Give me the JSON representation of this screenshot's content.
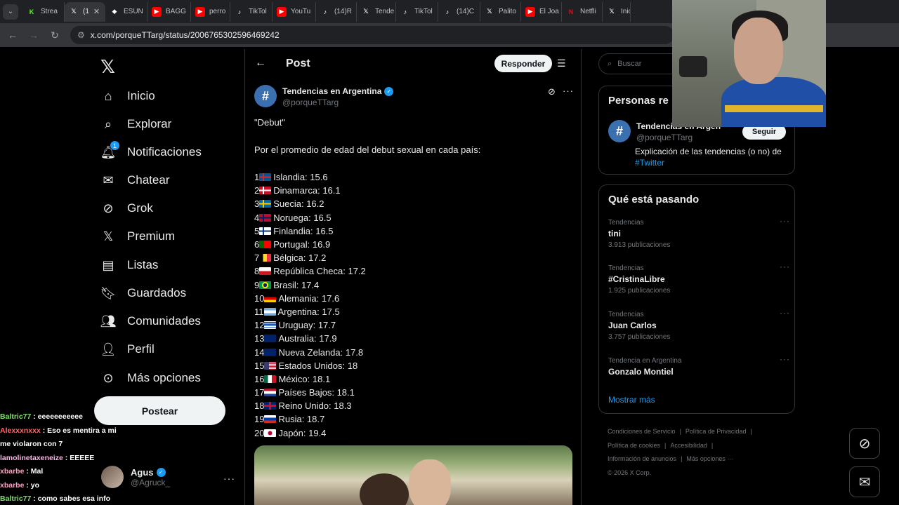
{
  "browser": {
    "tabs": [
      {
        "label": "Strea",
        "icon": "kick-icon",
        "color": "#53fc18"
      },
      {
        "label": "(1",
        "icon": "x-icon",
        "color": "#ffffff",
        "active": true
      },
      {
        "label": "ESUN",
        "icon": "esun-icon",
        "color": "#ffffff"
      },
      {
        "label": "BAGG",
        "icon": "youtube-icon",
        "color": "#ff0000"
      },
      {
        "label": "perro",
        "icon": "youtube-icon",
        "color": "#ff0000"
      },
      {
        "label": "TikTol",
        "icon": "tiktok-icon",
        "color": "#ffffff"
      },
      {
        "label": "YouTu",
        "icon": "youtube-icon",
        "color": "#ff0000"
      },
      {
        "label": "(14)R",
        "icon": "tiktok-icon",
        "color": "#ffffff"
      },
      {
        "label": "Tende",
        "icon": "x-icon",
        "color": "#ffffff"
      },
      {
        "label": "TikTol",
        "icon": "tiktok-icon",
        "color": "#ffffff"
      },
      {
        "label": "(14)C",
        "icon": "tiktok-icon",
        "color": "#ffffff"
      },
      {
        "label": "Palito",
        "icon": "x-icon",
        "color": "#ffffff"
      },
      {
        "label": "El Joa",
        "icon": "youtube-icon",
        "color": "#ff0000"
      },
      {
        "label": "Netfli",
        "icon": "netflix-icon",
        "color": "#e50914"
      },
      {
        "label": "Inic",
        "icon": "x-icon",
        "color": "#ffffff"
      }
    ],
    "url": "x.com/porqueTTarg/status/2006765302596469242"
  },
  "nav": {
    "items": [
      {
        "label": "Inicio",
        "icon": "home-icon"
      },
      {
        "label": "Explorar",
        "icon": "search-icon"
      },
      {
        "label": "Notificaciones",
        "icon": "bell-icon",
        "badge": "1"
      },
      {
        "label": "Chatear",
        "icon": "mail-icon"
      },
      {
        "label": "Grok",
        "icon": "grok-icon"
      },
      {
        "label": "Premium",
        "icon": "x-icon"
      },
      {
        "label": "Listas",
        "icon": "list-icon"
      },
      {
        "label": "Guardados",
        "icon": "bookmark-icon"
      },
      {
        "label": "Comunidades",
        "icon": "people-icon"
      },
      {
        "label": "Perfil",
        "icon": "person-icon"
      },
      {
        "label": "Más opciones",
        "icon": "more-circle-icon"
      }
    ],
    "post_button": "Postear",
    "account": {
      "name": "Agus",
      "handle": "@Agruck_"
    }
  },
  "chat": [
    {
      "user": "Baltric77",
      "text": " : eeeeeeeeeee"
    },
    {
      "user": "Alexxxnxxx",
      "text": " : Eso es mentira a mi"
    },
    {
      "user": "",
      "text": "me violaron con 7"
    },
    {
      "user": "lamolinetaxeneize",
      "text": " : EEEEE"
    },
    {
      "user": "xbarbe",
      "text": " : Mal"
    },
    {
      "user": "xbarbe",
      "text": " : yo"
    },
    {
      "user": "Baltric77",
      "text": " : como sabes esa info"
    }
  ],
  "main": {
    "title": "Post",
    "reply_button": "Responder",
    "author": {
      "name": "Tendencias en Argentina",
      "handle": "@porqueTTarg"
    },
    "text_line1": "\"Debut\"",
    "text_line2": "Por el promedio de edad del debut sexual en cada país:",
    "ranking": [
      {
        "n": "1",
        "country": "Islandia: 15.6",
        "flag": "is"
      },
      {
        "n": "2",
        "country": "Dinamarca: 16.1",
        "flag": "dk"
      },
      {
        "n": "3",
        "country": "Suecia: 16.2",
        "flag": "se"
      },
      {
        "n": "4",
        "country": "Noruega: 16.5",
        "flag": "no"
      },
      {
        "n": "5",
        "country": "Finlandia: 16.5",
        "flag": "fi"
      },
      {
        "n": "6",
        "country": "Portugal: 16.9",
        "flag": "pt"
      },
      {
        "n": "7",
        "country": "Bélgica: 17.2",
        "flag": "be"
      },
      {
        "n": "8",
        "country": "República Checa: 17.2",
        "flag": "cz"
      },
      {
        "n": "9",
        "country": "Brasil: 17.4",
        "flag": "br"
      },
      {
        "n": "10",
        "country": "Alemania: 17.6",
        "flag": "de"
      },
      {
        "n": "11",
        "country": "Argentina: 17.5",
        "flag": "ar"
      },
      {
        "n": "12",
        "country": "Uruguay: 17.7",
        "flag": "uy"
      },
      {
        "n": "13",
        "country": "Australia: 17.9",
        "flag": "au"
      },
      {
        "n": "14",
        "country": "Nueva Zelanda: 17.8",
        "flag": "nz"
      },
      {
        "n": "15",
        "country": "Estados Unidos: 18",
        "flag": "us"
      },
      {
        "n": "16",
        "country": "México: 18.1",
        "flag": "mx"
      },
      {
        "n": "17",
        "country": "Países Bajos: 18.1",
        "flag": "nl"
      },
      {
        "n": "18",
        "country": "Reino Unido: 18.3",
        "flag": "gb"
      },
      {
        "n": "19",
        "country": "Rusia: 18.7",
        "flag": "ru"
      },
      {
        "n": "20",
        "country": "Japón: 19.4",
        "flag": "jp"
      }
    ]
  },
  "right": {
    "search_placeholder": "Buscar",
    "related_title": "Personas re",
    "related": {
      "name": "Tendencias en Argen",
      "handle": "@porqueTTarg",
      "follow": "Seguir",
      "bio": "Explicación de las tendencias (o no) de",
      "bio_link": "#Twitter"
    },
    "trends_title": "Qué está pasando",
    "trends": [
      {
        "cat": "Tendencias",
        "title": "tini",
        "count": "3.913 publicaciones"
      },
      {
        "cat": "Tendencias",
        "title": "#CristinaLibre",
        "count": "1.925 publicaciones"
      },
      {
        "cat": "Tendencias",
        "title": "Juan Carlos",
        "count": "3.757 publicaciones"
      },
      {
        "cat": "Tendencia en Argentina",
        "title": "Gonzalo Montiel",
        "count": ""
      }
    ],
    "show_more": "Mostrar más",
    "footer": {
      "terms": "Condiciones de Servicio",
      "privacy": "Política de Privacidad",
      "cookies": "Política de cookies",
      "accessibility": "Accesibilidad",
      "ads": "Información de anuncios",
      "more": "Más opciones ···",
      "copyright": "© 2026 X Corp."
    }
  }
}
